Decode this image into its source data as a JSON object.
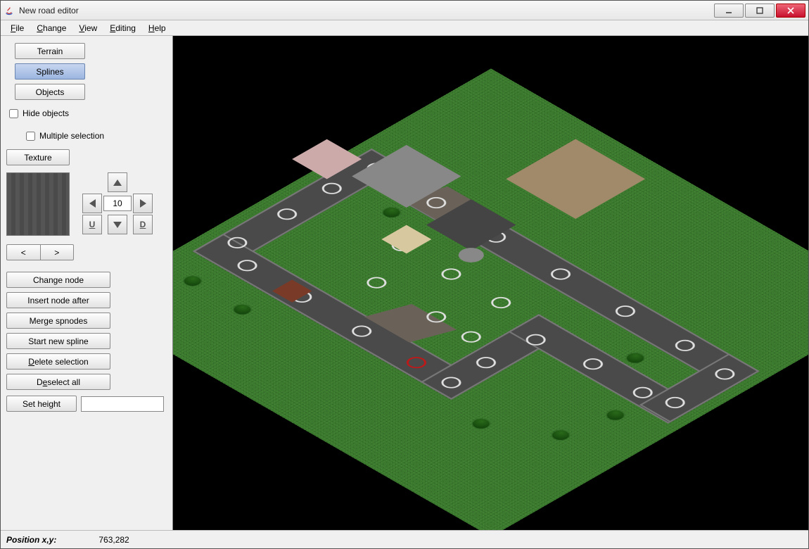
{
  "window": {
    "title": "New road editor"
  },
  "menubar": {
    "items": [
      "File",
      "Change",
      "View",
      "Editing",
      "Help"
    ]
  },
  "sidebar": {
    "tabs": {
      "terrain": "Terrain",
      "splines": "Splines",
      "objects": "Objects"
    },
    "check_hide": "Hide objects",
    "check_multi": "Multiple selection",
    "texture_btn": "Texture",
    "dpad_value": "10",
    "dpad_u": "U",
    "dpad_d": "D",
    "seg_prev": "<",
    "seg_next": ">",
    "actions": {
      "change_node": "Change node",
      "insert_after": "Insert node after",
      "merge": "Merge spnodes",
      "start_new": "Start new spline",
      "delete_sel": "Delete selection",
      "deselect": "Deselect all",
      "set_height": "Set height"
    },
    "set_height_value": ""
  },
  "statusbar": {
    "label": "Position x,y:",
    "value": "763,282"
  }
}
